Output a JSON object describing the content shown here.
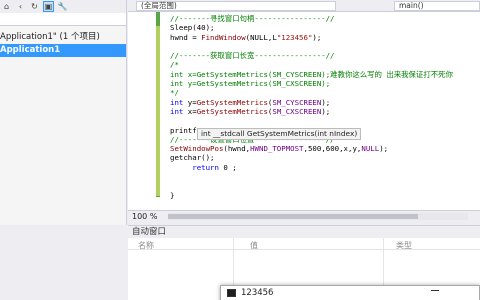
{
  "solution_explorer": {
    "toolbar_icons": [
      "home-icon",
      "back-icon",
      "refresh-icon",
      "show-all-files-icon",
      "properties-icon"
    ],
    "search_placeholder": "",
    "nodes": [
      {
        "label": "Application1\" (1 个项目)",
        "selected": false
      },
      {
        "label": "Application1",
        "selected": true
      }
    ]
  },
  "editor": {
    "nav_left": "(全局范围)",
    "nav_right": "main()",
    "lines": [
      [
        [
          "c-com",
          "//-------寻找窗口句柄----------------//"
        ]
      ],
      [
        [
          "c-txt",
          "Sleep(40);"
        ]
      ],
      [
        [
          "c-txt",
          "hwnd = "
        ],
        [
          "c-fn",
          "FindWindow"
        ],
        [
          "c-txt",
          "(NULL,L"
        ],
        [
          "c-str",
          "\"123456\""
        ],
        [
          "c-txt",
          ");"
        ]
      ],
      [
        [
          "c-txt",
          ""
        ]
      ],
      [
        [
          "c-com",
          "//-------获取窗口长宽----------------//"
        ]
      ],
      [
        [
          "c-com",
          "/*"
        ]
      ],
      [
        [
          "c-com",
          "int x=GetSystemMetrics(SM_CYSCREEN);难教你这么写的 出来我保证打不死你"
        ]
      ],
      [
        [
          "c-com",
          "int y=GetSystemMetrics(SM_CXSCREEN);"
        ]
      ],
      [
        [
          "c-com",
          "*/"
        ]
      ],
      [
        [
          "c-kw",
          "int"
        ],
        [
          "c-txt",
          " y="
        ],
        [
          "c-fn",
          "GetSystemMetrics"
        ],
        [
          "c-txt",
          "("
        ],
        [
          "c-macro",
          "SM_CYSCREEN"
        ],
        [
          "c-txt",
          ");"
        ]
      ],
      [
        [
          "c-kw",
          "int"
        ],
        [
          "c-txt",
          " x="
        ],
        [
          "c-fn",
          "GetSystemMetrics"
        ],
        [
          "c-txt",
          "("
        ],
        [
          "c-macro",
          "SM_CXSCREEN"
        ],
        [
          "c-txt",
          ");"
        ]
      ],
      [
        [
          "c-txt",
          ""
        ]
      ],
      [
        [
          "c-txt",
          "printf"
        ]
      ],
      [
        [
          "c-com",
          "//-------设置窗口位置----------------//"
        ]
      ],
      [
        [
          "c-fn",
          "SetWindowPos"
        ],
        [
          "c-txt",
          "(hwnd,"
        ],
        [
          "c-macro",
          "HWND_TOPMOST"
        ],
        [
          "c-txt",
          ",500,600,x,y,"
        ],
        [
          "c-macro",
          "NULL"
        ],
        [
          "c-txt",
          ");"
        ]
      ],
      [
        [
          "c-txt",
          "getchar();"
        ]
      ],
      [
        [
          "c-txt",
          "     "
        ],
        [
          "c-kw",
          "return"
        ],
        [
          "c-txt",
          " 0 ;"
        ]
      ],
      [
        [
          "c-txt",
          ""
        ]
      ],
      [
        [
          "c-txt",
          ""
        ]
      ],
      [
        [
          "c-txt",
          "}"
        ]
      ]
    ],
    "tooltip": "int __stdcall GetSystemMetrics(int nIndex)"
  },
  "zoom": "100 %",
  "autos": {
    "title": "自动窗口",
    "columns": [
      "名称",
      "值",
      "类型"
    ]
  },
  "console": {
    "title": "123456"
  }
}
